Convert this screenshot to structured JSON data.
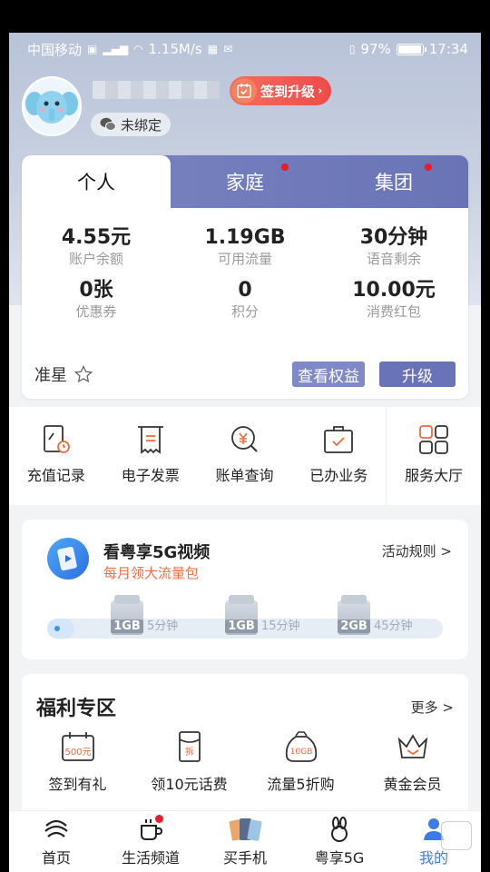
{
  "status_bar": {
    "carrier": "中国移动",
    "speed": "1.15M/s",
    "battery": "97%",
    "battery_level": 0.97,
    "time": "17:34"
  },
  "profile": {
    "signin_label": "签到升级",
    "bind_status": "未绑定"
  },
  "account": {
    "tabs": [
      {
        "label": "个人",
        "active": true,
        "dot": false
      },
      {
        "label": "家庭",
        "active": false,
        "dot": true
      },
      {
        "label": "集团",
        "active": false,
        "dot": true
      }
    ],
    "stats": [
      {
        "value": "4.55元",
        "label": "账户余额"
      },
      {
        "value": "1.19GB",
        "label": "可用流量"
      },
      {
        "value": "30分钟",
        "label": "语音剩余"
      },
      {
        "value": "0张",
        "label": "优惠券"
      },
      {
        "value": "0",
        "label": "积分"
      },
      {
        "value": "10.00元",
        "label": "消费红包"
      }
    ],
    "level": "准星",
    "rights_button": "查看权益",
    "upgrade_button": "升级"
  },
  "quick_actions": [
    {
      "label": "充值记录",
      "icon": "recharge-record-icon"
    },
    {
      "label": "电子发票",
      "icon": "invoice-icon"
    },
    {
      "label": "账单查询",
      "icon": "bill-query-icon"
    },
    {
      "label": "已办业务",
      "icon": "handled-business-icon"
    },
    {
      "label": "服务大厅",
      "icon": "service-hall-icon"
    }
  ],
  "promo": {
    "title": "看粤享5G视频",
    "subtitle": "每月领大流量包",
    "rule_link": "活动规则 >",
    "milestones": [
      {
        "gb": "1GB",
        "minutes": "5分钟"
      },
      {
        "gb": "1GB",
        "minutes": "15分钟"
      },
      {
        "gb": "2GB",
        "minutes": "45分钟"
      }
    ]
  },
  "welfare": {
    "title": "福利专区",
    "more": "更多 >",
    "items": [
      {
        "label": "签到有礼",
        "badge": "500元",
        "icon": "calendar-gift-icon"
      },
      {
        "label": "领10元话费",
        "badge": "拆",
        "icon": "red-envelope-icon"
      },
      {
        "label": "流量5折购",
        "badge": "10GB",
        "icon": "data-bag-icon"
      },
      {
        "label": "黄金会员",
        "badge": "",
        "icon": "crown-icon"
      }
    ]
  },
  "bottom_nav": [
    {
      "label": "首页",
      "icon": "home-logo-icon",
      "active": false
    },
    {
      "label": "生活频道",
      "icon": "coffee-cup-icon",
      "active": false,
      "dot": true
    },
    {
      "label": "买手机",
      "icon": "phones-icon",
      "active": false
    },
    {
      "label": "粤享5G",
      "icon": "rabbit-icon",
      "active": false
    },
    {
      "label": "我的",
      "icon": "user-icon",
      "active": true
    }
  ],
  "colors": {
    "accent_red": "#ee4b4b",
    "tab_purple": "#6974b6",
    "promo_orange": "#f07045",
    "nav_active": "#3f7be6"
  }
}
